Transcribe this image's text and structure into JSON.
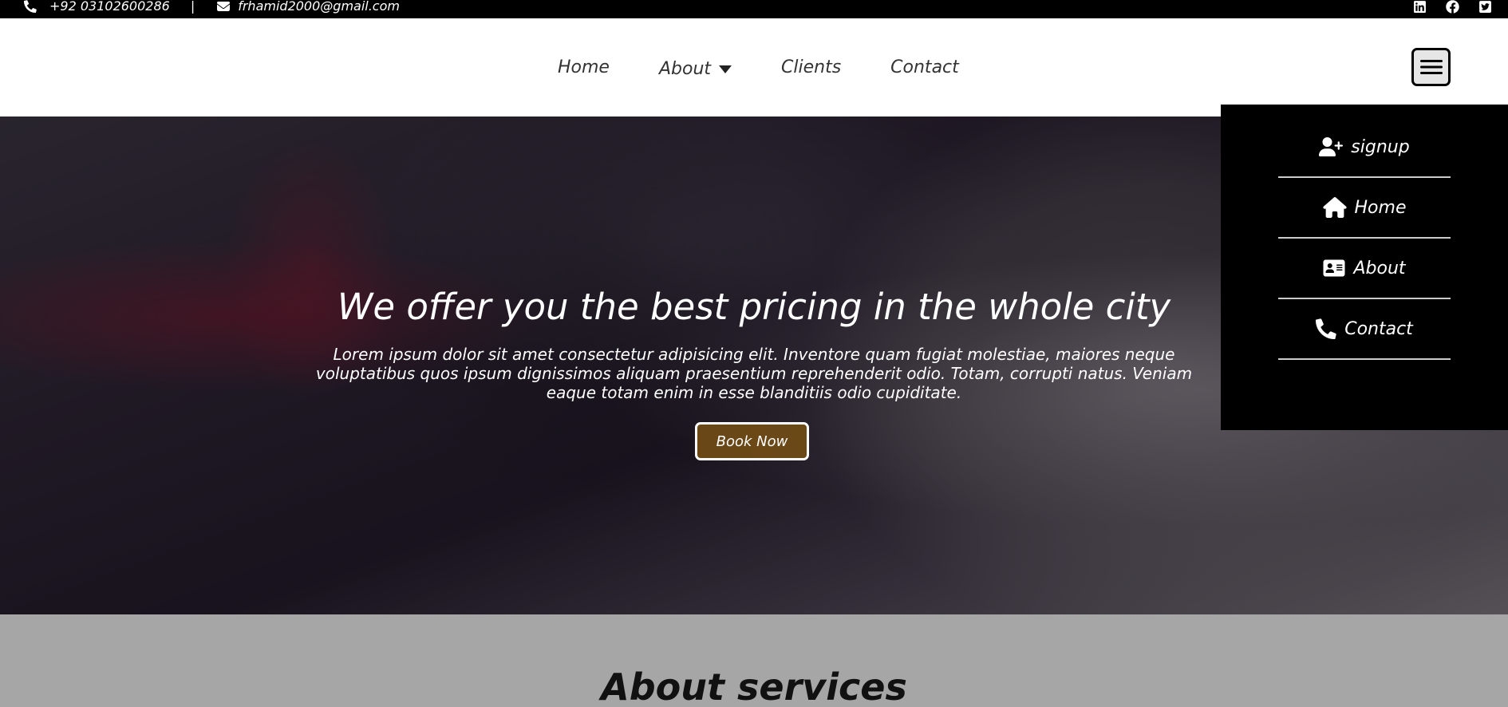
{
  "topbar": {
    "phone": "+92 03102600286",
    "separator": "|",
    "email": "frhamid2000@gmail.com",
    "social_icons": [
      "linkedin-icon",
      "facebook-icon",
      "twitter-icon"
    ]
  },
  "nav": {
    "items": [
      {
        "label": "Home"
      },
      {
        "label": "About"
      },
      {
        "label": "Clients"
      },
      {
        "label": "Contact"
      }
    ]
  },
  "hero": {
    "title": "We offer you the best pricing in the whole city",
    "text": "Lorem ipsum dolor sit amet consectetur adipisicing elit. Inventore quam fugiat molestiae, maiores neque voluptatibus quos ipsum dignissimos aliquam praesentium reprehenderit odio. Totam, corrupti natus. Veniam eaque totam enim in esse blanditiis odio cupiditate.",
    "button": "Book Now"
  },
  "dropdown": {
    "items": [
      {
        "label": "signup",
        "icon": "user-plus-icon"
      },
      {
        "label": "Home",
        "icon": "home-icon"
      },
      {
        "label": "About",
        "icon": "id-card-icon"
      },
      {
        "label": "Contact",
        "icon": "phone-icon"
      }
    ]
  },
  "about": {
    "title": "About services"
  },
  "colors": {
    "topbar": "#000000",
    "button_fill": "#78501a",
    "dropdown_bg": "#000000",
    "about_bg": "#a6a6a6"
  }
}
